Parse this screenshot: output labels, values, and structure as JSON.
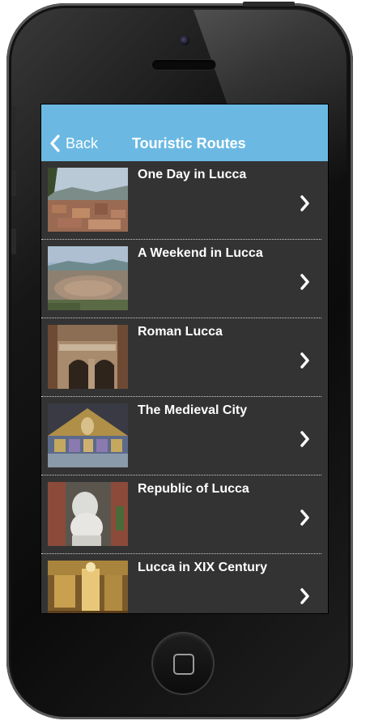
{
  "header": {
    "back_label": "Back",
    "title": "Touristic Routes",
    "background_color": "#6bb9e3"
  },
  "routes": [
    {
      "title": "One Day in Lucca",
      "thumbnail": "lucca-rooftops-photo"
    },
    {
      "title": "A Weekend in Lucca",
      "thumbnail": "lucca-aerial-city-photo"
    },
    {
      "title": "Roman Lucca",
      "thumbnail": "roman-arches-photo"
    },
    {
      "title": "The Medieval City",
      "thumbnail": "church-mosaic-facade-photo"
    },
    {
      "title": "Republic of Lucca",
      "thumbnail": "marble-lion-statue-photo"
    },
    {
      "title": "Lucca in XIX Century",
      "thumbnail": "palace-interior-photo"
    }
  ],
  "icons": {
    "back": "chevron-left-icon",
    "row_action": "chevron-right-icon"
  },
  "colors": {
    "list_background": "#333333",
    "text": "#ffffff"
  }
}
